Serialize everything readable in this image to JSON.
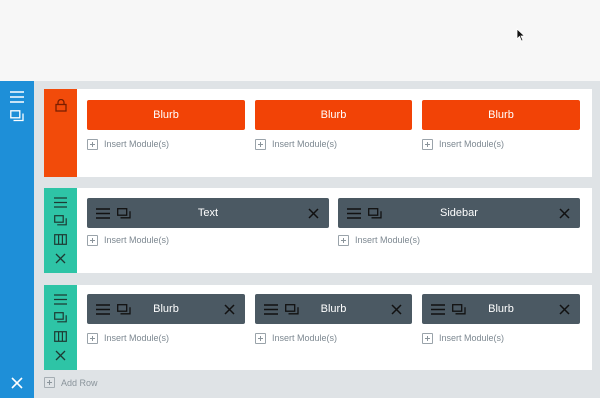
{
  "colors": {
    "section_bar": "#1e8fd8",
    "locked_row": "#f24b0a",
    "row_handle": "#2ec4a6",
    "module_orange": "#f24306",
    "module_dark": "#4b5963",
    "builder_bg": "#dfe3e6"
  },
  "icons": {
    "section": [
      "hamburger-icon",
      "duplicate-icon",
      "close-icon"
    ],
    "row_locked": [
      "lock-icon"
    ],
    "row_normal": [
      "hamburger-icon",
      "duplicate-icon",
      "columns-icon",
      "close-icon"
    ],
    "module": [
      "hamburger-icon",
      "duplicate-icon",
      "close-icon"
    ],
    "insert": "plus-square-icon"
  },
  "rows": [
    {
      "state": "locked",
      "modules": [
        {
          "label": "Blurb",
          "insert": "Insert Module(s)"
        },
        {
          "label": "Blurb",
          "insert": "Insert Module(s)"
        },
        {
          "label": "Blurb",
          "insert": "Insert Module(s)"
        }
      ]
    },
    {
      "state": "normal",
      "modules": [
        {
          "label": "Text",
          "insert": "Insert Module(s)"
        },
        {
          "label": "Sidebar",
          "insert": "Insert Module(s)"
        }
      ]
    },
    {
      "state": "normal",
      "modules": [
        {
          "label": "Blurb",
          "insert": "Insert Module(s)"
        },
        {
          "label": "Blurb",
          "insert": "Insert Module(s)"
        },
        {
          "label": "Blurb",
          "insert": "Insert Module(s)"
        }
      ]
    }
  ],
  "add_row_label": "Add Row"
}
